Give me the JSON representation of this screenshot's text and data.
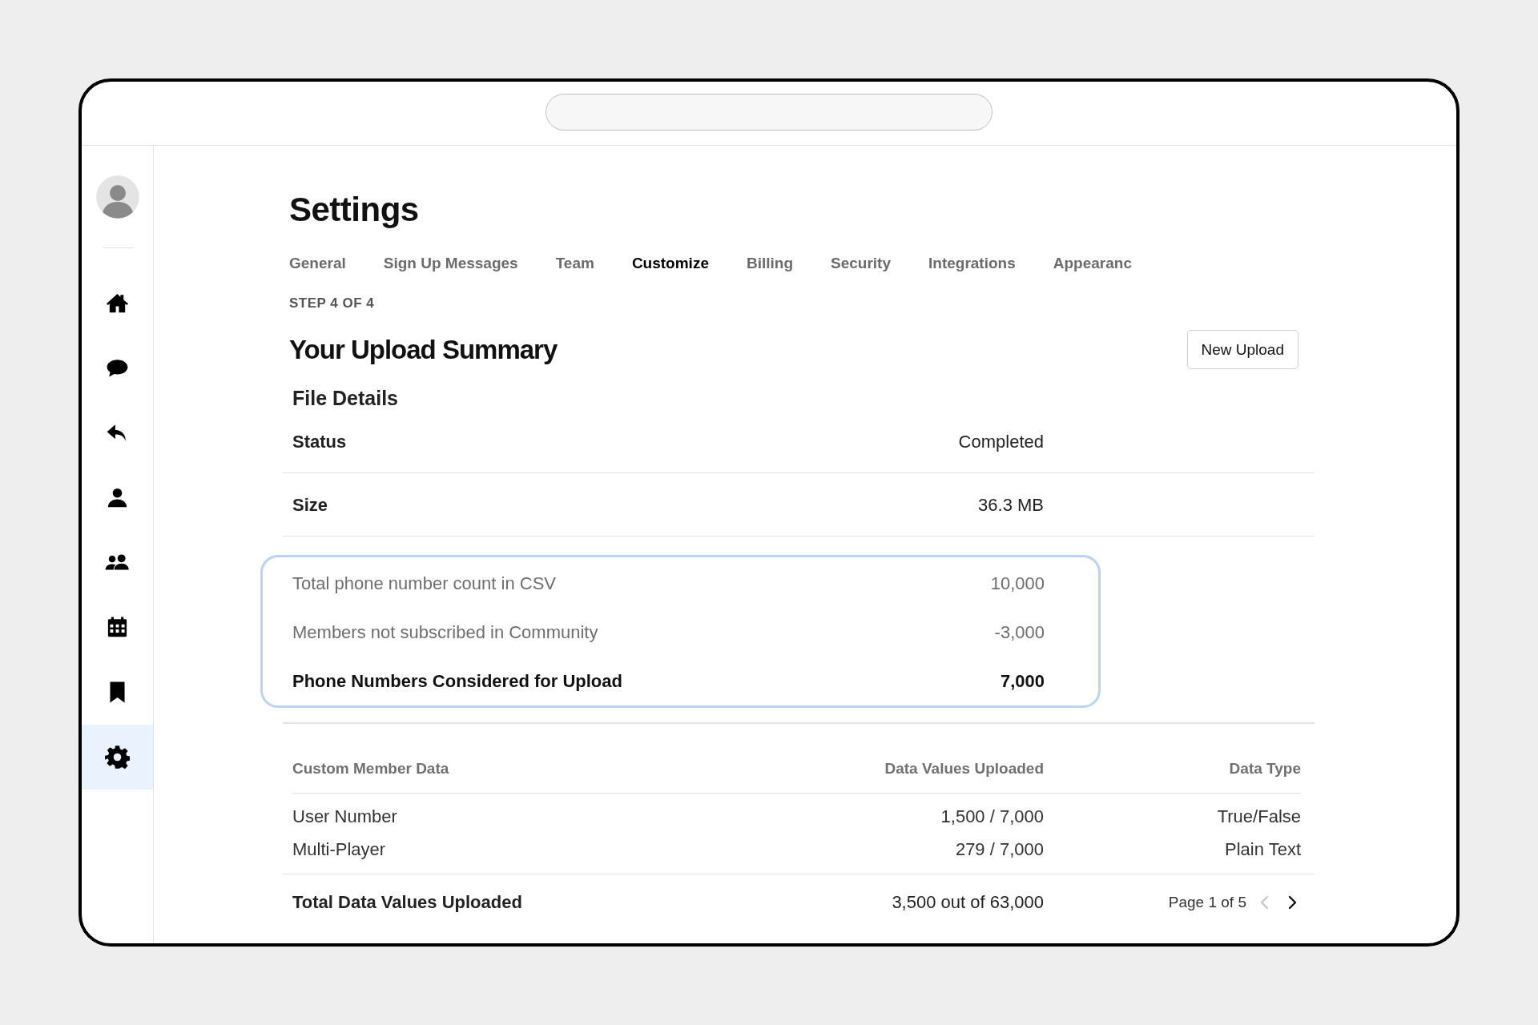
{
  "sidebar": {
    "items": [
      {
        "selected": false
      },
      {
        "selected": false
      },
      {
        "selected": false
      },
      {
        "selected": false
      },
      {
        "selected": false
      },
      {
        "selected": false
      },
      {
        "selected": false
      },
      {
        "selected": true
      }
    ]
  },
  "page_title": "Settings",
  "tabs": [
    {
      "label": "General",
      "selected": false
    },
    {
      "label": "Sign Up Messages",
      "selected": false
    },
    {
      "label": "Team",
      "selected": false
    },
    {
      "label": "Customize",
      "selected": true
    },
    {
      "label": "Billing",
      "selected": false
    },
    {
      "label": "Security",
      "selected": false
    },
    {
      "label": "Integrations",
      "selected": false
    },
    {
      "label": "Appearanc",
      "selected": false
    }
  ],
  "step": "STEP 4 OF 4",
  "summary_title": "Your Upload Summary",
  "new_upload_button": "New Upload",
  "file_details": {
    "title": "File Details",
    "rows": [
      {
        "label": "Status",
        "value": "Completed"
      },
      {
        "label": "Size",
        "value": "36.3 MB"
      }
    ]
  },
  "counts": {
    "rows": [
      {
        "label": "Total phone number count in CSV",
        "value": "10,000",
        "kind": "item"
      },
      {
        "label": "Members not subscribed in Community",
        "value": "-3,000",
        "kind": "item"
      },
      {
        "label": "Phone Numbers Considered for Upload",
        "value": "7,000",
        "kind": "total"
      }
    ]
  },
  "custom_data": {
    "columns": [
      "Custom Member Data",
      "Data Values Uploaded",
      "Data Type"
    ],
    "rows": [
      [
        "User Number",
        "1,500 / 7,000",
        "True/False"
      ],
      [
        "Multi-Player",
        "279 / 7,000",
        "Plain Text"
      ]
    ],
    "total": {
      "label": "Total Data Values Uploaded",
      "value": "3,500 out of 63,000"
    },
    "pagination": {
      "label": "Page 1 of 5",
      "prev_disabled": true,
      "next_disabled": false
    }
  }
}
